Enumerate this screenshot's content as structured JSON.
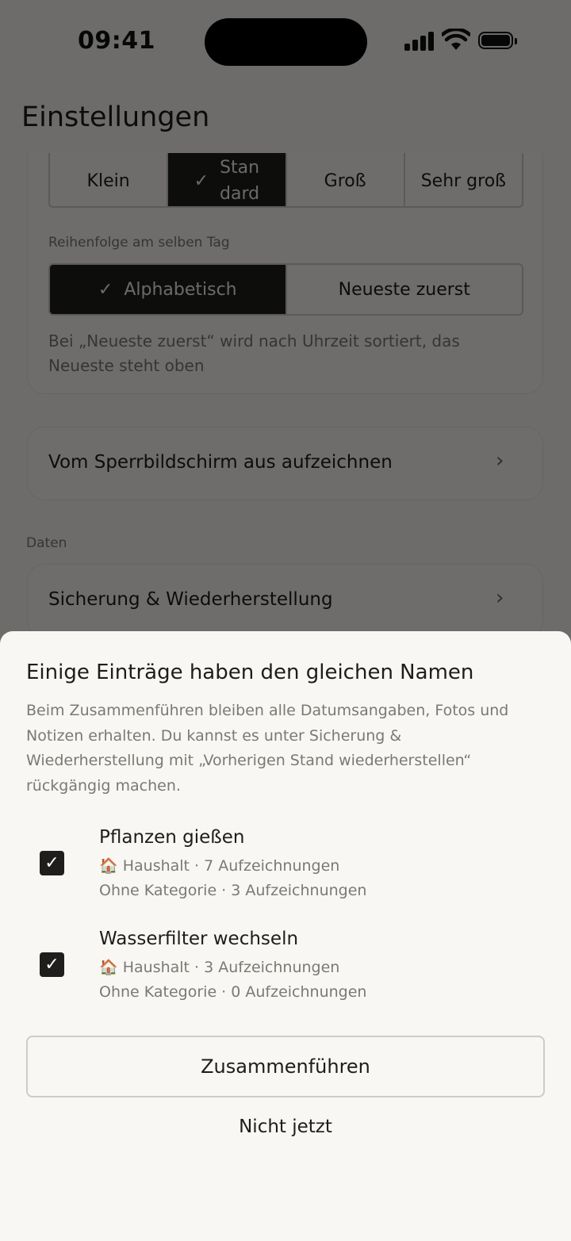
{
  "status_bar": {
    "time": "09:41"
  },
  "header": {
    "title": "Einstellungen"
  },
  "settings": {
    "size_options": [
      {
        "label": "Klein",
        "selected": false
      },
      {
        "label": "Standard",
        "selected": true
      },
      {
        "label": "Groß",
        "selected": false
      },
      {
        "label": "Sehr groß",
        "selected": false
      }
    ],
    "order_label": "Reihenfolge am selben Tag",
    "order_options": [
      {
        "label": "Alphabetisch",
        "selected": true
      },
      {
        "label": "Neueste zuerst",
        "selected": false
      }
    ],
    "order_note": "Bei „Neueste zuerst“ wird nach Uhrzeit sortiert, das Neueste steht oben",
    "lockscreen_row": "Vom Sperrbildschirm aus aufzeichnen",
    "data_section": "Daten",
    "backup_row": "Sicherung & Wiederherstellung"
  },
  "sheet": {
    "title": "Einige Einträge haben den gleichen Namen",
    "description": "Beim Zusammenführen bleiben alle Datumsangaben, Fotos und Notizen erhalten. Du kannst es unter Sicherung & Wiederherstellung mit „Vorherigen Stand wiederherstellen“ rückgängig machen.",
    "items": [
      {
        "checked": true,
        "name": "Pflanzen gießen",
        "line1_emoji": "🏠",
        "line1": "Haushalt · 7 Aufzeichnungen",
        "line2": "Ohne Kategorie · 3 Aufzeichnungen"
      },
      {
        "checked": true,
        "name": "Wasserfilter wechseln",
        "line1_emoji": "🏠",
        "line1": "Haushalt · 3 Aufzeichnungen",
        "line2": "Ohne Kategorie · 0 Aufzeichnungen"
      }
    ],
    "primary_button": "Zusammenführen",
    "secondary_button": "Nicht jetzt"
  },
  "icons": {
    "check": "check-icon",
    "chevron": "chevron-right-icon"
  }
}
